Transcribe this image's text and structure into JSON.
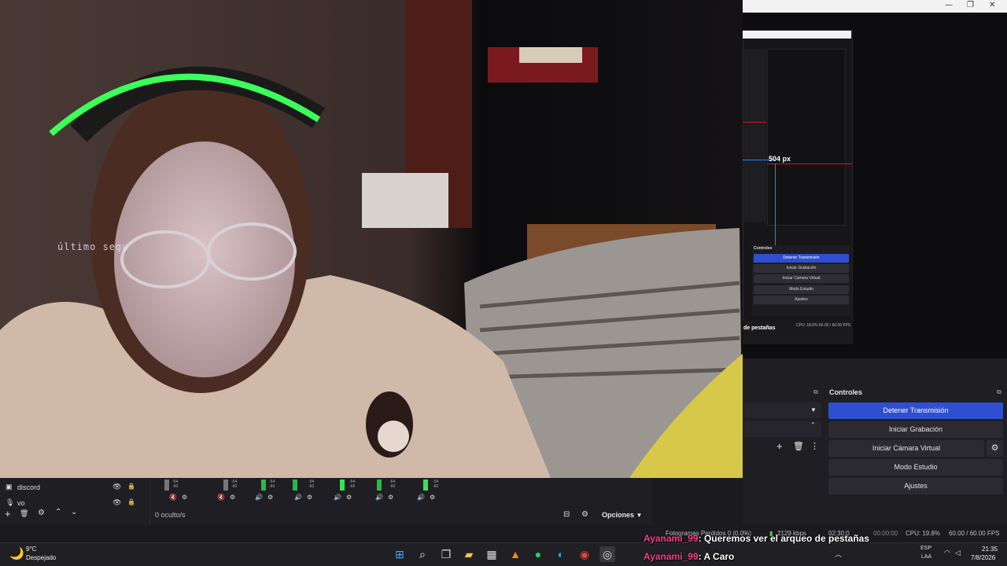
{
  "camera_overlay": {
    "text": "último segu"
  },
  "nested_obs": {
    "resize_label": "504 px",
    "controls_title": "Controles",
    "buttons": [
      "Detener Transmisión",
      "Iniciar Grabación",
      "Iniciar Cámara Virtual",
      "Modo Estudio",
      "Ajustes"
    ],
    "status_text": "de pestañas",
    "cpu": "CPU: 18.0%    60.00 / 60.00 FPS"
  },
  "controls": {
    "title": "Controles",
    "stop_stream": "Detener Transmisión",
    "start_recording": "Iniciar Grabación",
    "start_virtual_cam": "Iniciar Cámara Virtual",
    "studio_mode": "Modo Estudio",
    "settings": "Ajustes"
  },
  "sources": {
    "items": [
      {
        "label": "discord"
      },
      {
        "label": "vo"
      }
    ]
  },
  "mixer": {
    "channels": [
      {
        "db_top": "-54",
        "db_bottom": "-60"
      },
      {
        "db_top": "-54",
        "db_bottom": "-60"
      },
      {
        "db_top": "-54",
        "db_bottom": "-60"
      },
      {
        "db_top": "-54",
        "db_bottom": "-60"
      },
      {
        "db_top": "-54",
        "db_bottom": "-60"
      },
      {
        "db_top": "-54",
        "db_bottom": "-60"
      },
      {
        "db_top": "-54",
        "db_bottom": "-60"
      }
    ],
    "hidden_count": "0 oculto/s",
    "options_label": "Opciones"
  },
  "status_bar": {
    "frames_lost": "Fotogramas Perdidos 0 (0.0%)",
    "bitrate": "2129 kbps",
    "stream_time": "02:30:0",
    "rec_time": "00:00:00",
    "cpu": "CPU: 19.8%",
    "fps": "60.00 / 60.00 FPS"
  },
  "chat": [
    {
      "user": "Ayanami_99",
      "message": ": Queremos ver el arqueo de pestañas"
    },
    {
      "user": "Ayanami_99",
      "message": ": A Caro"
    }
  ],
  "taskbar": {
    "weather_temp": "9°C",
    "weather_desc": "Despejado",
    "lang_top": "ESP",
    "lang_bottom": "LAA",
    "time": "21:35",
    "date": "7/8/2026"
  },
  "colors": {
    "accent_blue": "#2f4fd3",
    "headset_green": "#3cff5a",
    "chat_user": "#ff3f8a"
  }
}
